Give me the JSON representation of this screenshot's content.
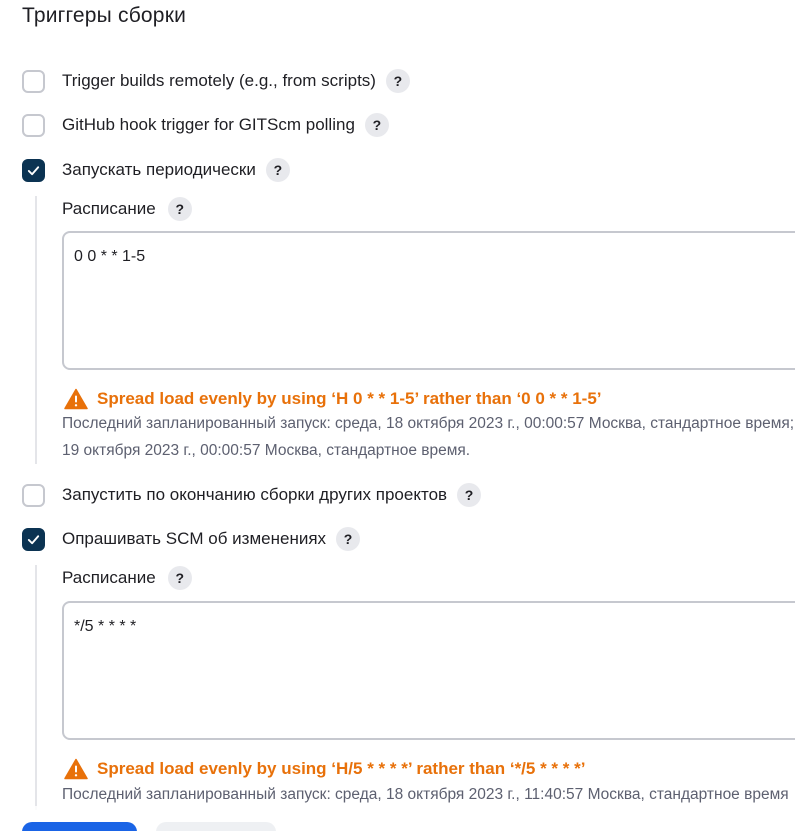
{
  "section": {
    "title": "Триггеры сборки"
  },
  "options": {
    "remote": {
      "label": "Trigger builds remotely (e.g., from scripts)",
      "checked": false
    },
    "github_hook": {
      "label": "GitHub hook trigger for GITScm polling",
      "checked": false
    },
    "periodic": {
      "label": "Запускать периодически",
      "checked": true
    },
    "after_other": {
      "label": "Запустить по окончанию сборки других проектов",
      "checked": false
    },
    "poll_scm": {
      "label": "Опрашивать SCM об изменениях",
      "checked": true
    }
  },
  "help_glyph": "?",
  "periodic_schedule": {
    "label": "Расписание",
    "value": "0 0 * * 1-5",
    "warning": "Spread load evenly by using ‘H 0 * * 1-5’ rather than ‘0 0 * * 1-5’",
    "info_line1": "Последний запланированный запуск: среда, 18 октября 2023 г., 00:00:57 Москва, стандартное время; Следующий запланированный запуск: четверг,",
    "info_line2": "19 октября 2023 г., 00:00:57 Москва, стандартное время."
  },
  "poll_schedule": {
    "label": "Расписание",
    "value": "*/5 * * * *",
    "warning": "Spread load evenly by using ‘H/5 * * * *’ rather than ‘*/5 * * * *’",
    "info_line1": "Последний запланированный запуск: среда, 18 октября 2023 г., 11:40:57 Москва, стандартное время"
  },
  "colors": {
    "checkbox_checked": "#0b3352",
    "warning": "#e8710a",
    "help_bg": "#e8e9ed",
    "primary_button": "#1a64e6"
  },
  "icons": {
    "check": "check-icon",
    "help": "question-mark-icon",
    "warning": "warning-triangle-icon"
  }
}
